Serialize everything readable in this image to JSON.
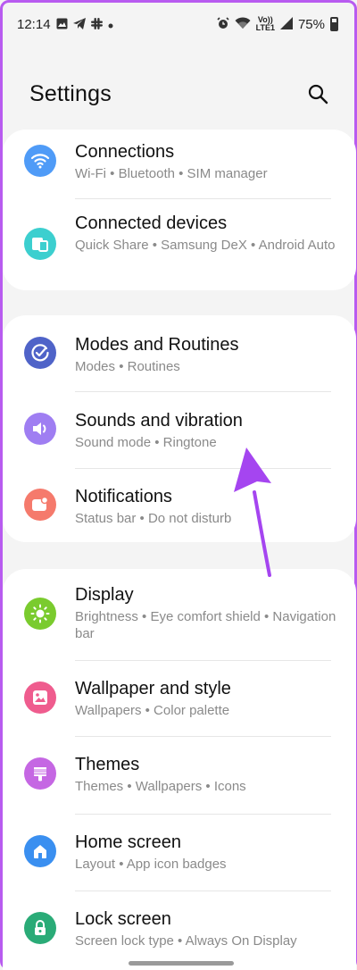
{
  "status_bar": {
    "time": "12:14",
    "volte": "Vo))",
    "lte": "LTE1",
    "battery": "75%",
    "icons": [
      "gallery-icon",
      "telegram-icon",
      "slack-icon",
      "dot-icon",
      "alarm-icon",
      "wifi-icon",
      "signal-icon",
      "battery-icon"
    ]
  },
  "header": {
    "title": "Settings",
    "search_icon": "search-icon"
  },
  "groups": [
    {
      "items": [
        {
          "title": "Connections",
          "subtitle": "Wi-Fi  •  Bluetooth  •  SIM manager",
          "icon": "wifi-icon",
          "color": "#4f9bf7"
        },
        {
          "title": "Connected devices",
          "subtitle": "Quick Share  •  Samsung DeX  •  Android Auto",
          "icon": "devices-icon",
          "color": "#3ccfcf"
        }
      ]
    },
    {
      "items": [
        {
          "title": "Modes and Routines",
          "subtitle": "Modes  •  Routines",
          "icon": "check-circle-icon",
          "color": "#4f63c8"
        },
        {
          "title": "Sounds and vibration",
          "subtitle": "Sound mode  •  Ringtone",
          "icon": "speaker-icon",
          "color": "#9f7ef2"
        },
        {
          "title": "Notifications",
          "subtitle": "Status bar  •  Do not disturb",
          "icon": "notification-icon",
          "color": "#f57a6c"
        }
      ]
    },
    {
      "items": [
        {
          "title": "Display",
          "subtitle": "Brightness  •  Eye comfort shield  •  Navigation bar",
          "icon": "sun-icon",
          "color": "#7acb2e"
        },
        {
          "title": "Wallpaper and style",
          "subtitle": "Wallpapers  •  Color palette",
          "icon": "image-icon",
          "color": "#ef5c8e"
        },
        {
          "title": "Themes",
          "subtitle": "Themes  •  Wallpapers  •  Icons",
          "icon": "brush-icon",
          "color": "#c567e3"
        },
        {
          "title": "Home screen",
          "subtitle": "Layout  •  App icon badges",
          "icon": "home-icon",
          "color": "#3a8ff0"
        },
        {
          "title": "Lock screen",
          "subtitle": "Screen lock type  •  Always On Display",
          "icon": "lock-icon",
          "color": "#2aab77"
        }
      ]
    }
  ],
  "annotation": {
    "color": "#a545f0"
  }
}
